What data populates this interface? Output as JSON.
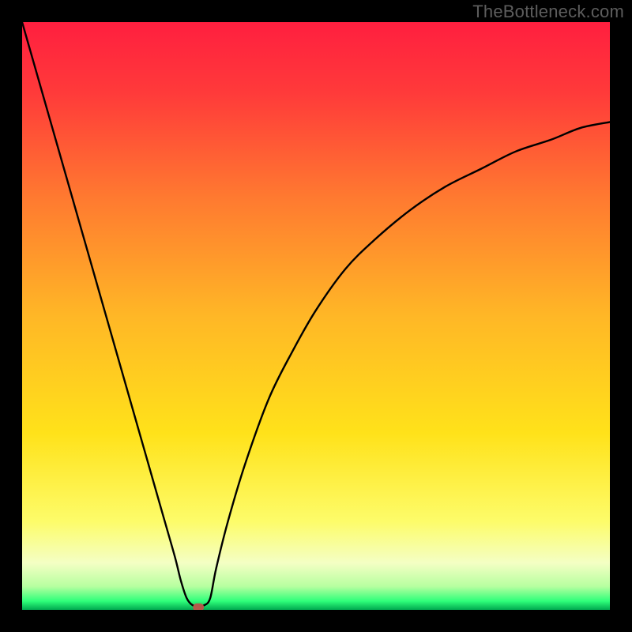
{
  "watermark": "TheBottleneck.com",
  "chart_data": {
    "type": "line",
    "title": "",
    "xlabel": "",
    "ylabel": "",
    "xlim": [
      0,
      100
    ],
    "ylim": [
      0,
      100
    ],
    "gradient_stops": [
      {
        "offset": 0.0,
        "color": "#ff1f3f"
      },
      {
        "offset": 0.12,
        "color": "#ff3a3a"
      },
      {
        "offset": 0.3,
        "color": "#ff7a30"
      },
      {
        "offset": 0.5,
        "color": "#ffb726"
      },
      {
        "offset": 0.7,
        "color": "#ffe21a"
      },
      {
        "offset": 0.85,
        "color": "#fdfc6a"
      },
      {
        "offset": 0.92,
        "color": "#f4ffc4"
      },
      {
        "offset": 0.96,
        "color": "#b7ffa0"
      },
      {
        "offset": 0.985,
        "color": "#2fff7a"
      },
      {
        "offset": 1.0,
        "color": "#00a84f"
      }
    ],
    "series": [
      {
        "name": "bottleneck-curve",
        "x": [
          0,
          2,
          4,
          6,
          8,
          10,
          12,
          14,
          16,
          18,
          20,
          22,
          24,
          26,
          27,
          28,
          29,
          30,
          31,
          32,
          33,
          35,
          38,
          42,
          46,
          50,
          55,
          60,
          66,
          72,
          78,
          84,
          90,
          95,
          100
        ],
        "values": [
          100,
          93,
          86,
          79,
          72,
          65,
          58,
          51,
          44,
          37,
          30,
          23,
          16,
          9,
          5,
          2,
          0.8,
          0.8,
          0.8,
          2,
          7,
          15,
          25,
          36,
          44,
          51,
          58,
          63,
          68,
          72,
          75,
          78,
          80,
          82,
          83
        ]
      }
    ],
    "marker": {
      "x": 30,
      "y": 0.3,
      "color": "#b35a4a",
      "shape": "rounded-rect"
    }
  }
}
